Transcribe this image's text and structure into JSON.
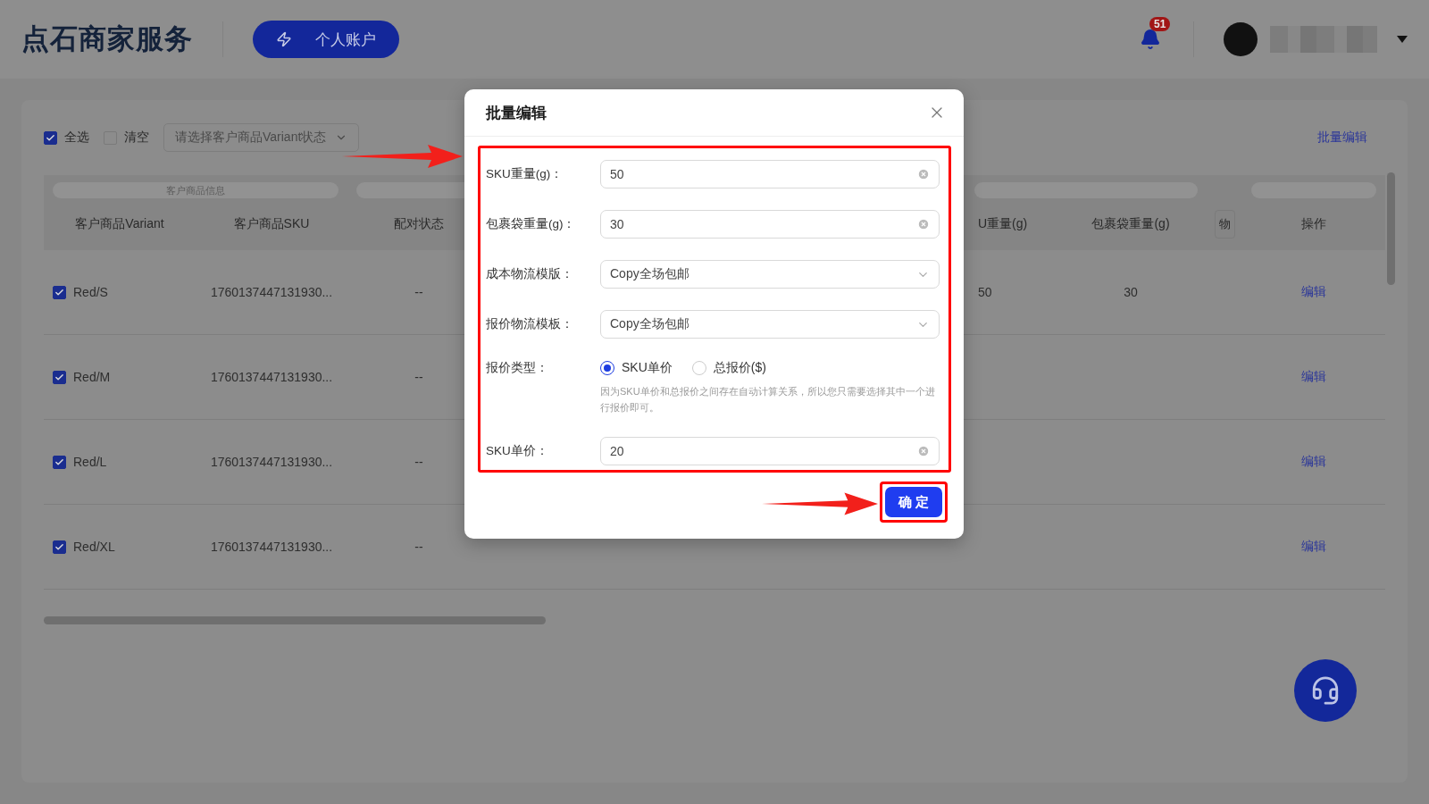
{
  "header": {
    "logo": "点石商家服务",
    "account_button": "个人账户",
    "notification_count": "51"
  },
  "toolbar": {
    "select_all": {
      "label": "全选",
      "checked": true
    },
    "clear": {
      "label": "清空",
      "checked": false
    },
    "status_filter": {
      "placeholder": "请选择客户商品Variant状态"
    },
    "batch_edit": "批量编辑"
  },
  "table": {
    "column_group": "客户商品信息",
    "columns": [
      "客户商品Variant",
      "客户商品SKU",
      "配对状态",
      "U重量(g)",
      "包裹袋重量(g)",
      "物",
      "操作"
    ],
    "rows": [
      {
        "selected": true,
        "variant": "Red/S",
        "sku": "1760137447131930...",
        "status": "--",
        "weight": "50",
        "bag_weight": "30",
        "action": "编辑"
      },
      {
        "selected": true,
        "variant": "Red/M",
        "sku": "1760137447131930...",
        "status": "--",
        "action": "编辑"
      },
      {
        "selected": true,
        "variant": "Red/L",
        "sku": "1760137447131930...",
        "status": "--",
        "action": "编辑"
      },
      {
        "selected": true,
        "variant": "Red/XL",
        "sku": "1760137447131930...",
        "status": "--",
        "action": "编辑"
      }
    ]
  },
  "dialog": {
    "title": "批量编辑",
    "fields": [
      {
        "kind": "input",
        "label": "SKU重量(g)：",
        "value": "50"
      },
      {
        "kind": "input",
        "label": "包裹袋重量(g)：",
        "value": "30"
      },
      {
        "kind": "select",
        "label": "成本物流模版：",
        "value": "Copy全场包邮"
      },
      {
        "kind": "select",
        "label": "报价物流模板：",
        "value": "Copy全场包邮"
      },
      {
        "kind": "radio",
        "label": "报价类型：",
        "options": [
          {
            "label": "SKU单价",
            "selected": true
          },
          {
            "label": "总报价($)",
            "selected": false
          }
        ],
        "hint": "因为SKU单价和总报价之间存在自动计算关系，所以您只需要选择其中一个进行报价即可。"
      },
      {
        "kind": "input",
        "label": "SKU单价：",
        "value": "20"
      }
    ],
    "confirm": "确 定"
  }
}
